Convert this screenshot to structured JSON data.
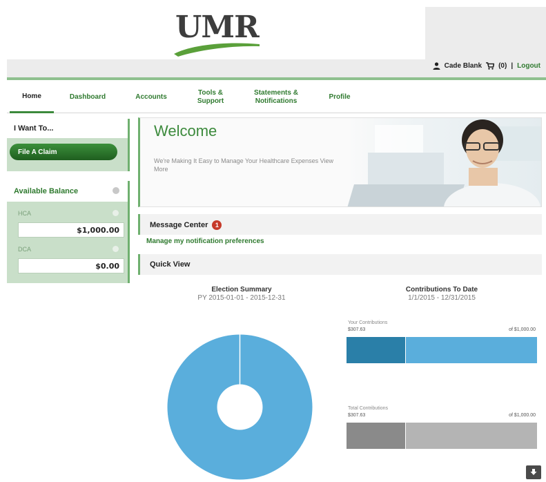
{
  "header": {
    "logo_text": "UMR",
    "user_name": "Cade Blank",
    "cart_count": "(0)",
    "logout_label": "Logout"
  },
  "nav": {
    "items": [
      {
        "label": "Home",
        "active": true
      },
      {
        "label": "Dashboard"
      },
      {
        "label": "Accounts"
      },
      {
        "label": "Tools &\nSupport"
      },
      {
        "label": "Statements &\nNotifications"
      },
      {
        "label": "Profile"
      }
    ]
  },
  "sidebar": {
    "i_want_label": "I Want To...",
    "file_claim_label": "File A Claim",
    "available_balance_label": "Available Balance",
    "accounts": [
      {
        "label": "HCA",
        "amount": "$1,000.00"
      },
      {
        "label": "DCA",
        "amount": "$0.00"
      }
    ]
  },
  "welcome": {
    "title": "Welcome",
    "text": "We're Making It Easy to Manage Your Healthcare Expenses View",
    "more_label": "More"
  },
  "message_center": {
    "title": "Message Center",
    "badge": "1",
    "link": "Manage my notification preferences"
  },
  "quick_view": {
    "title": "Quick View",
    "election_summary": {
      "title": "Election Summary",
      "subtitle": "PY 2015-01-01 - 2015-12-31"
    },
    "contributions": {
      "title": "Contributions To Date",
      "subtitle": "1/1/2015 - 12/31/2015",
      "your_label": "Your Contributions",
      "your_value": "$307.63",
      "your_of": "of $1,000.00",
      "total_label": "Total Contributions",
      "total_value": "$307.63",
      "total_of": "of $1,000.00"
    }
  },
  "colors": {
    "brand_green": "#3c8a3c",
    "donut_blue": "#5aaedc",
    "bar_dark_blue": "#2a7fa8",
    "bar_light_blue": "#5aaedc",
    "bar_dark_gray": "#8a8a8a",
    "bar_light_gray": "#b4b4b4"
  },
  "chart_data": [
    {
      "type": "pie",
      "title": "Election Summary",
      "subtitle": "PY 2015-01-01 - 2015-12-31",
      "slices": [
        {
          "value": 100
        }
      ],
      "donut": true
    },
    {
      "type": "bar",
      "title": "Contributions To Date",
      "subtitle": "1/1/2015 - 12/31/2015",
      "orientation": "horizontal",
      "stacked": true,
      "categories": [
        "Your Contributions",
        "Total Contributions"
      ],
      "values": [
        307.63,
        307.63
      ],
      "max": [
        1000,
        1000
      ]
    }
  ]
}
